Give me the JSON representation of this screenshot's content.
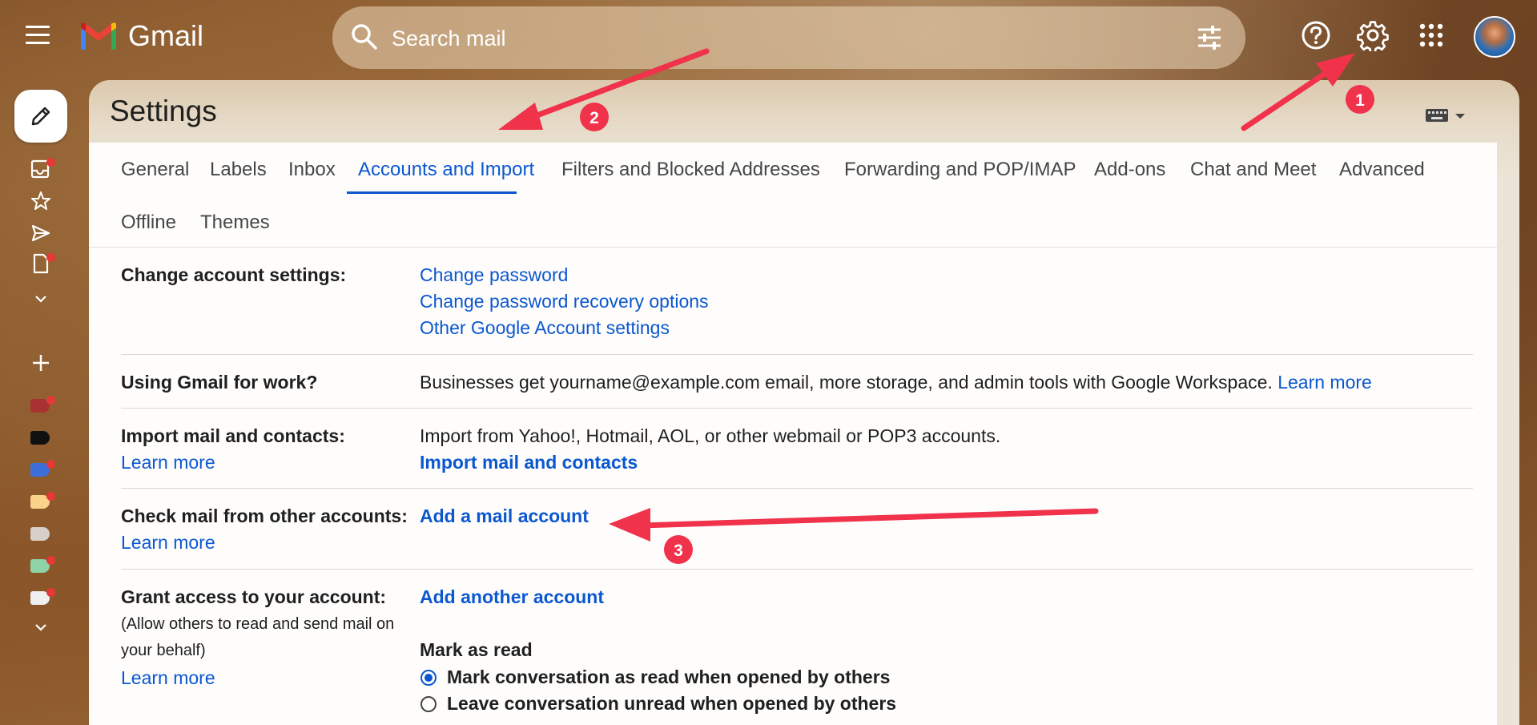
{
  "header": {
    "app_name": "Gmail",
    "search_placeholder": "Search mail"
  },
  "icons": {
    "menu": "menu-icon",
    "search": "search-icon",
    "tune": "tune-icon",
    "help": "help-icon",
    "settings": "gear-icon",
    "apps": "apps-grid-icon",
    "avatar": "avatar",
    "compose": "pencil-icon",
    "keyboard": "keyboard-icon"
  },
  "page": {
    "title": "Settings"
  },
  "tabs": [
    {
      "label": "General"
    },
    {
      "label": "Labels"
    },
    {
      "label": "Inbox"
    },
    {
      "label": "Accounts and Import",
      "active": true
    },
    {
      "label": "Filters and Blocked Addresses"
    },
    {
      "label": "Forwarding and POP/IMAP"
    },
    {
      "label": "Add-ons"
    },
    {
      "label": "Chat and Meet"
    },
    {
      "label": "Advanced"
    },
    {
      "label": "Offline"
    },
    {
      "label": "Themes"
    }
  ],
  "rows": {
    "change_account": {
      "label": "Change account settings:",
      "links": [
        "Change password",
        "Change password recovery options",
        "Other Google Account settings"
      ]
    },
    "work": {
      "label": "Using Gmail for work?",
      "text": "Businesses get yourname@example.com email, more storage, and admin tools with Google Workspace.",
      "link": "Learn more"
    },
    "import": {
      "label": "Import mail and contacts:",
      "learn_more": "Learn more",
      "text": "Import from Yahoo!, Hotmail, AOL, or other webmail or POP3 accounts.",
      "action": "Import mail and contacts"
    },
    "check_mail": {
      "label": "Check mail from other accounts:",
      "learn_more": "Learn more",
      "action": "Add a mail account"
    },
    "grant": {
      "label": "Grant access to your account:",
      "note_line1": "(Allow others to read and send mail on",
      "note_line2": "your behalf)",
      "learn_more": "Learn more",
      "action": "Add another account",
      "mark_as_read_title": "Mark as read",
      "options": [
        {
          "label": "Mark conversation as read when opened by others",
          "checked": true
        },
        {
          "label": "Leave conversation unread when opened by others",
          "checked": false
        }
      ]
    }
  },
  "annotations": {
    "badge_1": "1",
    "badge_2": "2",
    "badge_3": "3",
    "color": "#f0324b"
  },
  "colors": {
    "link": "#0b57d0",
    "active_tab": "#0b57d0",
    "text": "#1f1f1f",
    "notification_dot": "#e53935"
  }
}
